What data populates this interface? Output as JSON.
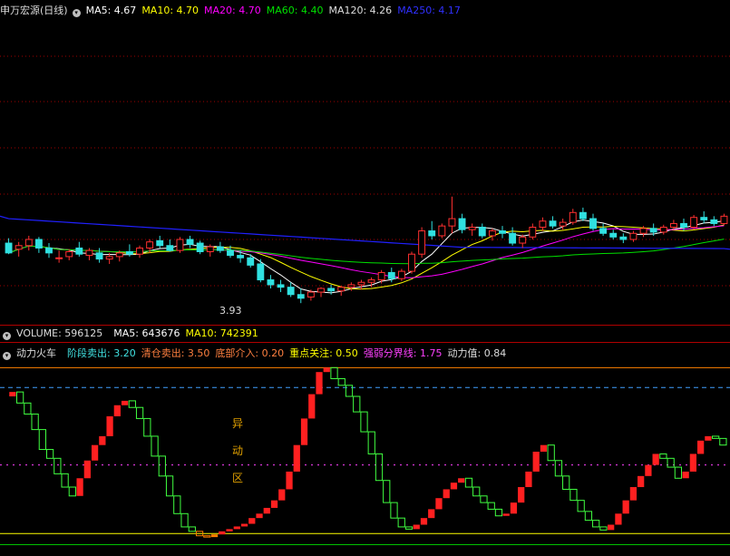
{
  "colors": {
    "bg": "#000000",
    "up": "#ff3030",
    "down": "#30e0e0",
    "grid": "#a00000",
    "ma5": "#ffffff",
    "ma10": "#ffff00",
    "ma20": "#ff00ff",
    "ma60": "#00e000",
    "ma250": "#2020ff",
    "osc_up": "#ff2020",
    "osc_down": "#40ff40",
    "osc_bottom": "#ff8000"
  },
  "price_panel": {
    "title": "申万宏源(日线)",
    "ma": [
      {
        "label": "MA5: 4.67",
        "color": "#ffffff"
      },
      {
        "label": "MA10: 4.70",
        "color": "#ffff00"
      },
      {
        "label": "MA20: 4.70",
        "color": "#ff00ff"
      },
      {
        "label": "MA60: 4.40",
        "color": "#00e000"
      },
      {
        "label": "MA120: 4.26",
        "color": "#dddddd"
      },
      {
        "label": "MA250: 4.17",
        "color": "#3030ff"
      }
    ],
    "low_label": "3.93"
  },
  "volume_panel": {
    "label": "VOLUME: 596125",
    "ma": [
      {
        "label": "MA5: 643676",
        "color": "#ffffff"
      },
      {
        "label": "MA10: 742391",
        "color": "#ffff00"
      }
    ]
  },
  "osc_panel": {
    "title": "动力火车",
    "items": [
      {
        "label": "阶段卖出: 3.20",
        "color": "#40e0e0"
      },
      {
        "label": "清仓卖出: 3.50",
        "color": "#ff8040"
      },
      {
        "label": "底部介入: 0.20",
        "color": "#ff8040"
      },
      {
        "label": "重点关注: 0.50",
        "color": "#ffff00"
      },
      {
        "label": "强弱分界线: 1.75",
        "color": "#ff40ff"
      },
      {
        "label": "动力值: 0.84",
        "color": "#dddddd"
      }
    ],
    "zone_chars": [
      "异",
      "动",
      "区"
    ]
  },
  "chart_data": {
    "type": "candlestick",
    "candles": [
      [
        4.42,
        4.46,
        4.33,
        4.34
      ],
      [
        4.37,
        4.43,
        4.31,
        4.4
      ],
      [
        4.4,
        4.48,
        4.36,
        4.45
      ],
      [
        4.45,
        4.47,
        4.34,
        4.38
      ],
      [
        4.38,
        4.42,
        4.3,
        4.34
      ],
      [
        4.3,
        4.36,
        4.26,
        4.3
      ],
      [
        4.31,
        4.37,
        4.28,
        4.35
      ],
      [
        4.38,
        4.43,
        4.31,
        4.33
      ],
      [
        4.32,
        4.38,
        4.28,
        4.36
      ],
      [
        4.34,
        4.38,
        4.26,
        4.29
      ],
      [
        4.29,
        4.34,
        4.25,
        4.31
      ],
      [
        4.31,
        4.36,
        4.27,
        4.34
      ],
      [
        4.35,
        4.41,
        4.31,
        4.33
      ],
      [
        4.33,
        4.4,
        4.3,
        4.38
      ],
      [
        4.38,
        4.45,
        4.34,
        4.43
      ],
      [
        4.44,
        4.48,
        4.38,
        4.4
      ],
      [
        4.4,
        4.45,
        4.35,
        4.36
      ],
      [
        4.36,
        4.47,
        4.34,
        4.45
      ],
      [
        4.45,
        4.48,
        4.38,
        4.41
      ],
      [
        4.42,
        4.44,
        4.33,
        4.35
      ],
      [
        4.35,
        4.41,
        4.31,
        4.39
      ],
      [
        4.39,
        4.43,
        4.34,
        4.36
      ],
      [
        4.36,
        4.4,
        4.3,
        4.32
      ],
      [
        4.32,
        4.36,
        4.26,
        4.3
      ],
      [
        4.3,
        4.33,
        4.22,
        4.24
      ],
      [
        4.25,
        4.29,
        4.1,
        4.12
      ],
      [
        4.12,
        4.16,
        4.05,
        4.08
      ],
      [
        4.08,
        4.12,
        4.02,
        4.06
      ],
      [
        4.06,
        4.1,
        3.98,
        4.0
      ],
      [
        4.0,
        4.05,
        3.93,
        3.97
      ],
      [
        3.98,
        4.04,
        3.95,
        4.02
      ],
      [
        4.02,
        4.06,
        3.98,
        4.05
      ],
      [
        4.05,
        4.08,
        4.0,
        4.03
      ],
      [
        4.03,
        4.07,
        3.99,
        4.06
      ],
      [
        4.06,
        4.1,
        4.03,
        4.08
      ],
      [
        4.08,
        4.12,
        4.04,
        4.1
      ],
      [
        4.1,
        4.14,
        4.06,
        4.12
      ],
      [
        4.12,
        4.2,
        4.09,
        4.18
      ],
      [
        4.18,
        4.22,
        4.1,
        4.13
      ],
      [
        4.13,
        4.21,
        4.11,
        4.19
      ],
      [
        4.19,
        4.35,
        4.17,
        4.33
      ],
      [
        4.33,
        4.55,
        4.3,
        4.52
      ],
      [
        4.52,
        4.6,
        4.45,
        4.48
      ],
      [
        4.48,
        4.58,
        4.46,
        4.56
      ],
      [
        4.56,
        4.8,
        4.5,
        4.62
      ],
      [
        4.62,
        4.66,
        4.5,
        4.53
      ],
      [
        4.53,
        4.58,
        4.48,
        4.55
      ],
      [
        4.55,
        4.58,
        4.46,
        4.48
      ],
      [
        4.48,
        4.54,
        4.44,
        4.52
      ],
      [
        4.52,
        4.56,
        4.46,
        4.5
      ],
      [
        4.5,
        4.55,
        4.4,
        4.42
      ],
      [
        4.42,
        4.49,
        4.38,
        4.47
      ],
      [
        4.47,
        4.58,
        4.45,
        4.55
      ],
      [
        4.55,
        4.63,
        4.52,
        4.6
      ],
      [
        4.6,
        4.64,
        4.54,
        4.56
      ],
      [
        4.56,
        4.62,
        4.53,
        4.59
      ],
      [
        4.59,
        4.7,
        4.57,
        4.67
      ],
      [
        4.67,
        4.71,
        4.6,
        4.62
      ],
      [
        4.62,
        4.66,
        4.52,
        4.54
      ],
      [
        4.54,
        4.58,
        4.48,
        4.5
      ],
      [
        4.5,
        4.53,
        4.45,
        4.47
      ],
      [
        4.47,
        4.5,
        4.42,
        4.45
      ],
      [
        4.45,
        4.52,
        4.43,
        4.5
      ],
      [
        4.5,
        4.56,
        4.47,
        4.54
      ],
      [
        4.54,
        4.58,
        4.48,
        4.51
      ],
      [
        4.51,
        4.57,
        4.49,
        4.55
      ],
      [
        4.55,
        4.61,
        4.53,
        4.58
      ],
      [
        4.58,
        4.62,
        4.52,
        4.55
      ],
      [
        4.55,
        4.65,
        4.53,
        4.63
      ],
      [
        4.63,
        4.68,
        4.58,
        4.61
      ],
      [
        4.61,
        4.64,
        4.56,
        4.58
      ],
      [
        4.58,
        4.66,
        4.57,
        4.64
      ]
    ],
    "osc": [
      3.3,
      3.4,
      3.15,
      2.9,
      2.55,
      2.1,
      1.9,
      1.55,
      1.25,
      1.05,
      1.45,
      1.85,
      2.2,
      2.4,
      2.85,
      3.1,
      3.2,
      3.05,
      2.8,
      2.4,
      1.95,
      1.5,
      1.05,
      0.65,
      0.35,
      0.25,
      0.15,
      0.12,
      0.18,
      0.25,
      0.3,
      0.36,
      0.42,
      0.55,
      0.65,
      0.78,
      0.95,
      1.2,
      1.6,
      2.2,
      2.8,
      3.35,
      3.85,
      3.95,
      3.7,
      3.55,
      3.3,
      2.95,
      2.5,
      2.0,
      1.4,
      0.9,
      0.55,
      0.35,
      0.3,
      0.4,
      0.55,
      0.75,
      1.0,
      1.2,
      1.35,
      1.45,
      1.25,
      1.05,
      0.9,
      0.75,
      0.6,
      0.65,
      0.9,
      1.25,
      1.6,
      2.05,
      2.2,
      1.85,
      1.5,
      1.2,
      0.95,
      0.7,
      0.5,
      0.35,
      0.28,
      0.4,
      0.65,
      0.95,
      1.25,
      1.5,
      1.75,
      2.0,
      1.9,
      1.7,
      1.45,
      1.6,
      2.0,
      2.3,
      2.4,
      2.35,
      2.2
    ]
  }
}
